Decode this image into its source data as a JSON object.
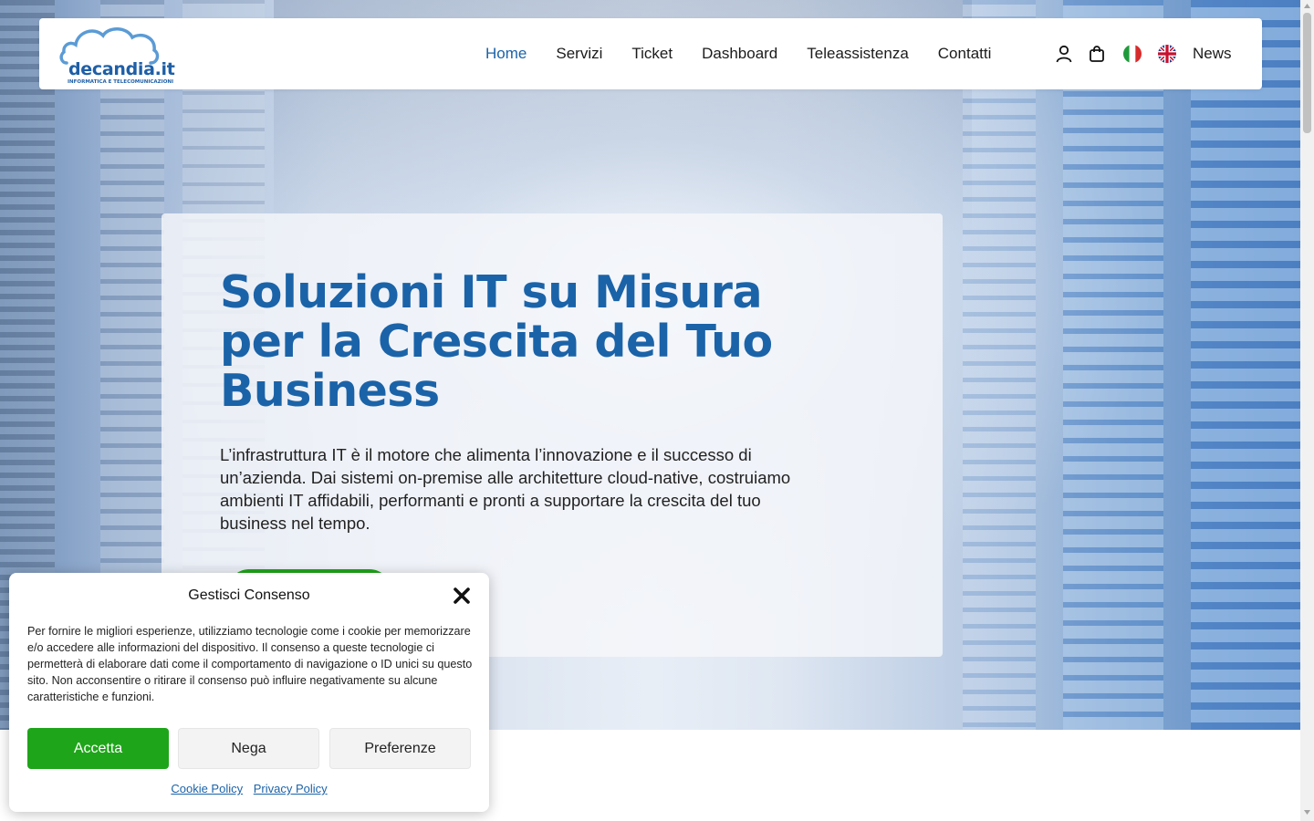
{
  "header": {
    "logo_text": "decandia.it",
    "logo_subtitle": "INFORMATICA E TELECOMUNICAZIONI",
    "nav": [
      {
        "label": "Home",
        "active": true
      },
      {
        "label": "Servizi"
      },
      {
        "label": "Ticket"
      },
      {
        "label": "Dashboard"
      },
      {
        "label": "Teleassistenza"
      },
      {
        "label": "Contatti"
      }
    ],
    "icons": [
      "user-icon",
      "shopping-bag-icon",
      "italy-flag-icon",
      "uk-flag-icon"
    ],
    "news_label": "News"
  },
  "hero": {
    "title": "Soluzioni IT su Misura per la Crescita del Tuo Business",
    "description": "L’infrastruttura IT è il motore che alimenta l’innovazione e il successo di un’azienda. Dai sistemi on-premise alle architetture cloud-native, costruiamo ambienti IT affidabili, performanti e pronti a supportare la crescita del tuo business nel tempo."
  },
  "cookie_dialog": {
    "title": "Gestisci Consenso",
    "text": "Per fornire le migliori esperienze, utilizziamo tecnologie come i cookie per memorizzare e/o accedere alle informazioni del dispositivo. Il consenso a queste tecnologie ci permetterà di elaborare dati come il comportamento di navigazione o ID unici su questo sito. Non acconsentire o ritirare il consenso può influire negativamente su alcune caratteristiche e funzioni.",
    "accept_label": "Accetta",
    "deny_label": "Nega",
    "preferences_label": "Preferenze",
    "cookie_policy_label": "Cookie Policy",
    "privacy_policy_label": "Privacy Policy"
  },
  "colors": {
    "brand_blue": "#1b63a8",
    "accept_green": "#1fa51a"
  }
}
